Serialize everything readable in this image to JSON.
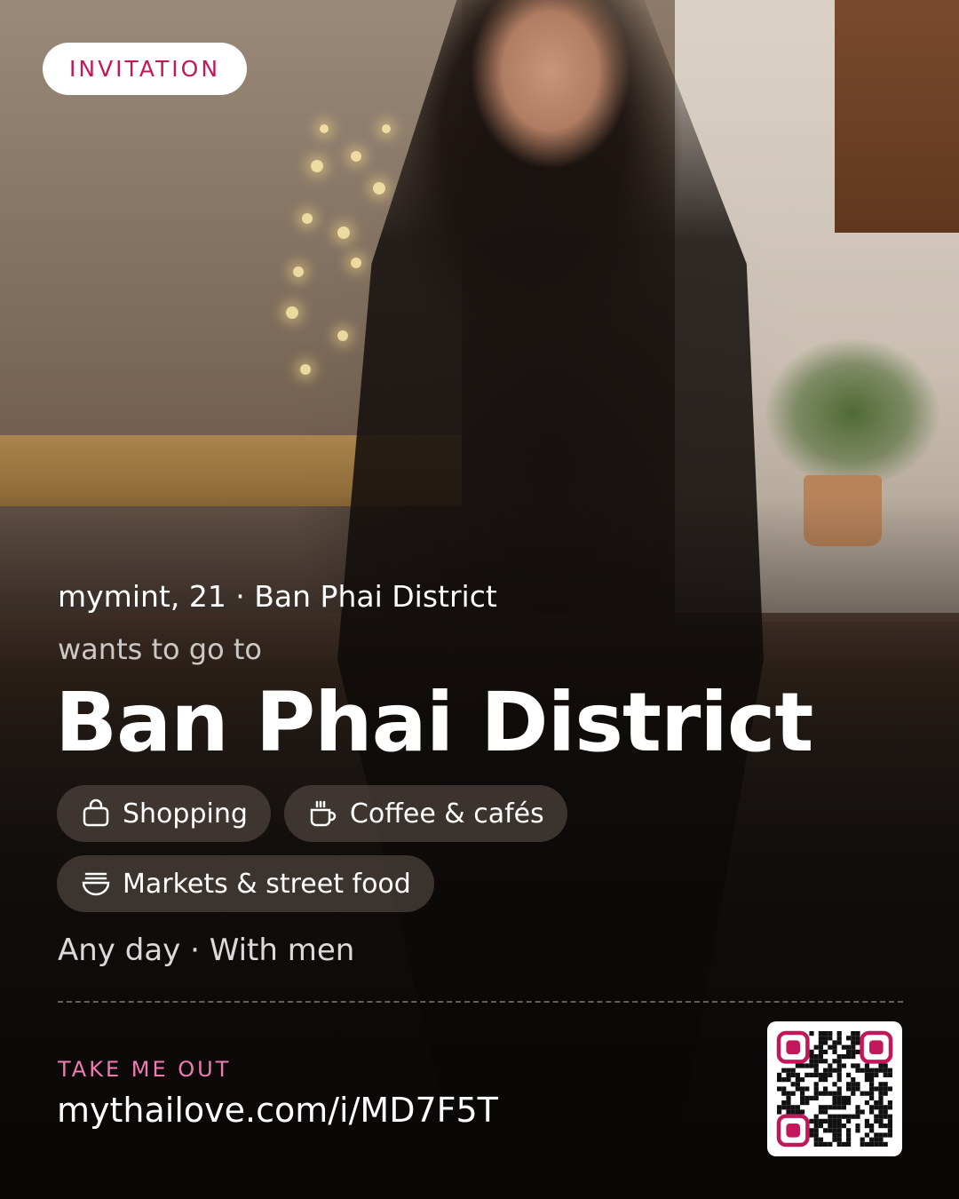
{
  "badge": {
    "label": "INVITATION"
  },
  "profile": {
    "meta": "mymint, 21 · Ban Phai District",
    "intro": "wants to go to",
    "destination": "Ban Phai District"
  },
  "interests": [
    {
      "label": "Shopping",
      "icon": "shopping-bag-icon"
    },
    {
      "label": "Coffee & cafés",
      "icon": "coffee-cup-icon"
    },
    {
      "label": "Markets & street food",
      "icon": "food-bowl-icon"
    }
  ],
  "schedule": "Any day · With men",
  "cta": {
    "label": "TAKE ME OUT",
    "url": "mythailove.com/i/MD7F5T"
  },
  "colors": {
    "accent": "#c2185b",
    "accent_light": "#f27ab4",
    "qr_finder": "#c2185b"
  }
}
